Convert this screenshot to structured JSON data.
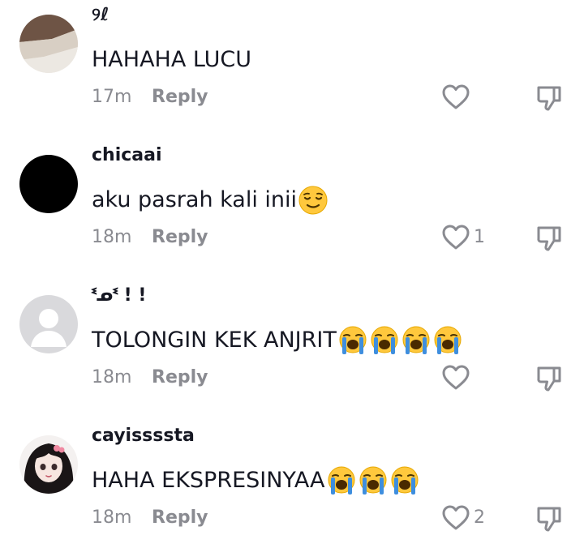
{
  "comments": [
    {
      "username": "୨ℓ",
      "text": "HAHAHA LUCU",
      "emoji_count": 0,
      "emoji": "",
      "time": "17m",
      "reply_label": "Reply",
      "like_count": "",
      "avatar": "photo-beige"
    },
    {
      "username": "chicaai",
      "text": "aku pasrah kali inii",
      "emoji_count": 1,
      "emoji": "relieved-face",
      "time": "18m",
      "reply_label": "Reply",
      "like_count": "1",
      "avatar": "black"
    },
    {
      "username": "ᓫᓄᓫ ! !",
      "text": "TOLONGIN KEK ANJRIT",
      "emoji_count": 4,
      "emoji": "loudly-crying-face",
      "time": "18m",
      "reply_label": "Reply",
      "like_count": "",
      "avatar": "default-gray"
    },
    {
      "username": "cayissssta",
      "text": "HAHA EKSPRESINYAA",
      "emoji_count": 3,
      "emoji": "loudly-crying-face",
      "time": "18m",
      "reply_label": "Reply",
      "like_count": "2",
      "avatar": "anime-girl"
    }
  ],
  "colors": {
    "text": "#161823",
    "muted": "#8a8b91",
    "emoji_yellow": "#ffc83d",
    "tears": "#3e8ede"
  }
}
